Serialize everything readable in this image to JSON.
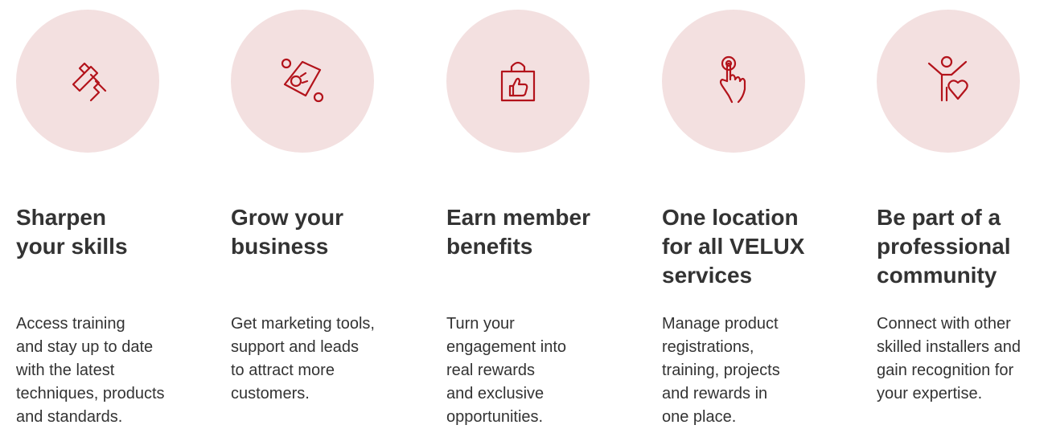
{
  "accent_color": "#b3131b",
  "circle_color": "#f3e0e0",
  "features": [
    {
      "icon": "hammer-icon",
      "title": "Sharpen\nyour skills",
      "description": "Access training\nand stay up to date\nwith the latest\ntechniques, products\nand standards."
    },
    {
      "icon": "discount-tag-icon",
      "title": "Grow your\nbusiness",
      "description": "Get marketing tools,\nsupport and leads\nto attract more\ncustomers."
    },
    {
      "icon": "shopping-bag-thumbs-up-icon",
      "title": "Earn member\nbenefits",
      "description": "Turn your\nengagement into\nreal rewards\nand exclusive\nopportunities."
    },
    {
      "icon": "pointing-hand-icon",
      "title": "One location\nfor all VELUX\nservices",
      "description": "Manage product\nregistrations,\ntraining, projects\nand rewards in\none place."
    },
    {
      "icon": "person-heart-icon",
      "title": "Be part of a\nprofessional\ncommunity",
      "description": "Connect with other\nskilled installers and\ngain recognition for\nyour expertise."
    }
  ]
}
